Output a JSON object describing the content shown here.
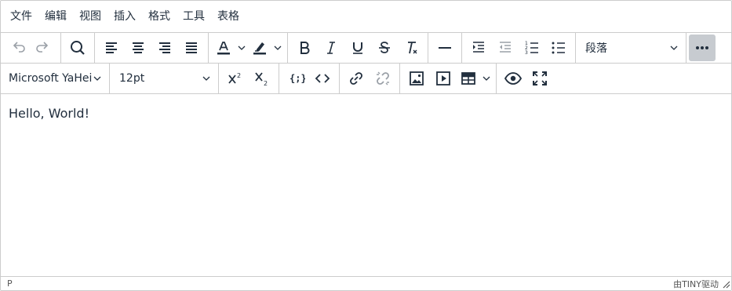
{
  "menubar": [
    "文件",
    "编辑",
    "视图",
    "插入",
    "格式",
    "工具",
    "表格"
  ],
  "toolbar": {
    "block_format": "段落",
    "font_family": "Microsoft YaHei",
    "font_size": "12pt"
  },
  "icons": {
    "undo": "undo-icon",
    "redo": "redo-icon",
    "search": "search-icon",
    "align_left": "align-left-icon",
    "align_center": "align-center-icon",
    "align_right": "align-right-icon",
    "align_justify": "align-justify-icon",
    "text_color": "text-color-icon",
    "highlight": "highlight-icon",
    "bold": "bold-icon",
    "italic": "italic-icon",
    "underline": "underline-icon",
    "strikethrough": "strikethrough-icon",
    "remove_format": "remove-format-icon",
    "hr": "horizontal-rule-icon",
    "indent": "indent-icon",
    "outdent": "outdent-icon",
    "ordered_list": "ordered-list-icon",
    "bullet_list": "bullet-list-icon",
    "more": "more-icon",
    "superscript": "superscript-icon",
    "subscript": "subscript-icon",
    "code_sample": "code-sample-icon",
    "source_code": "source-code-icon",
    "link": "link-icon",
    "unlink": "unlink-icon",
    "image": "image-icon",
    "media": "media-icon",
    "table": "table-icon",
    "preview": "preview-icon",
    "fullscreen": "fullscreen-icon"
  },
  "accent_colors": {
    "more_bg": "#c7cbd0",
    "border": "#cccccc",
    "text": "#222f3e"
  },
  "content": {
    "text": "Hello, World!"
  },
  "statusbar": {
    "path": "P",
    "branding": "由TINY驱动"
  }
}
